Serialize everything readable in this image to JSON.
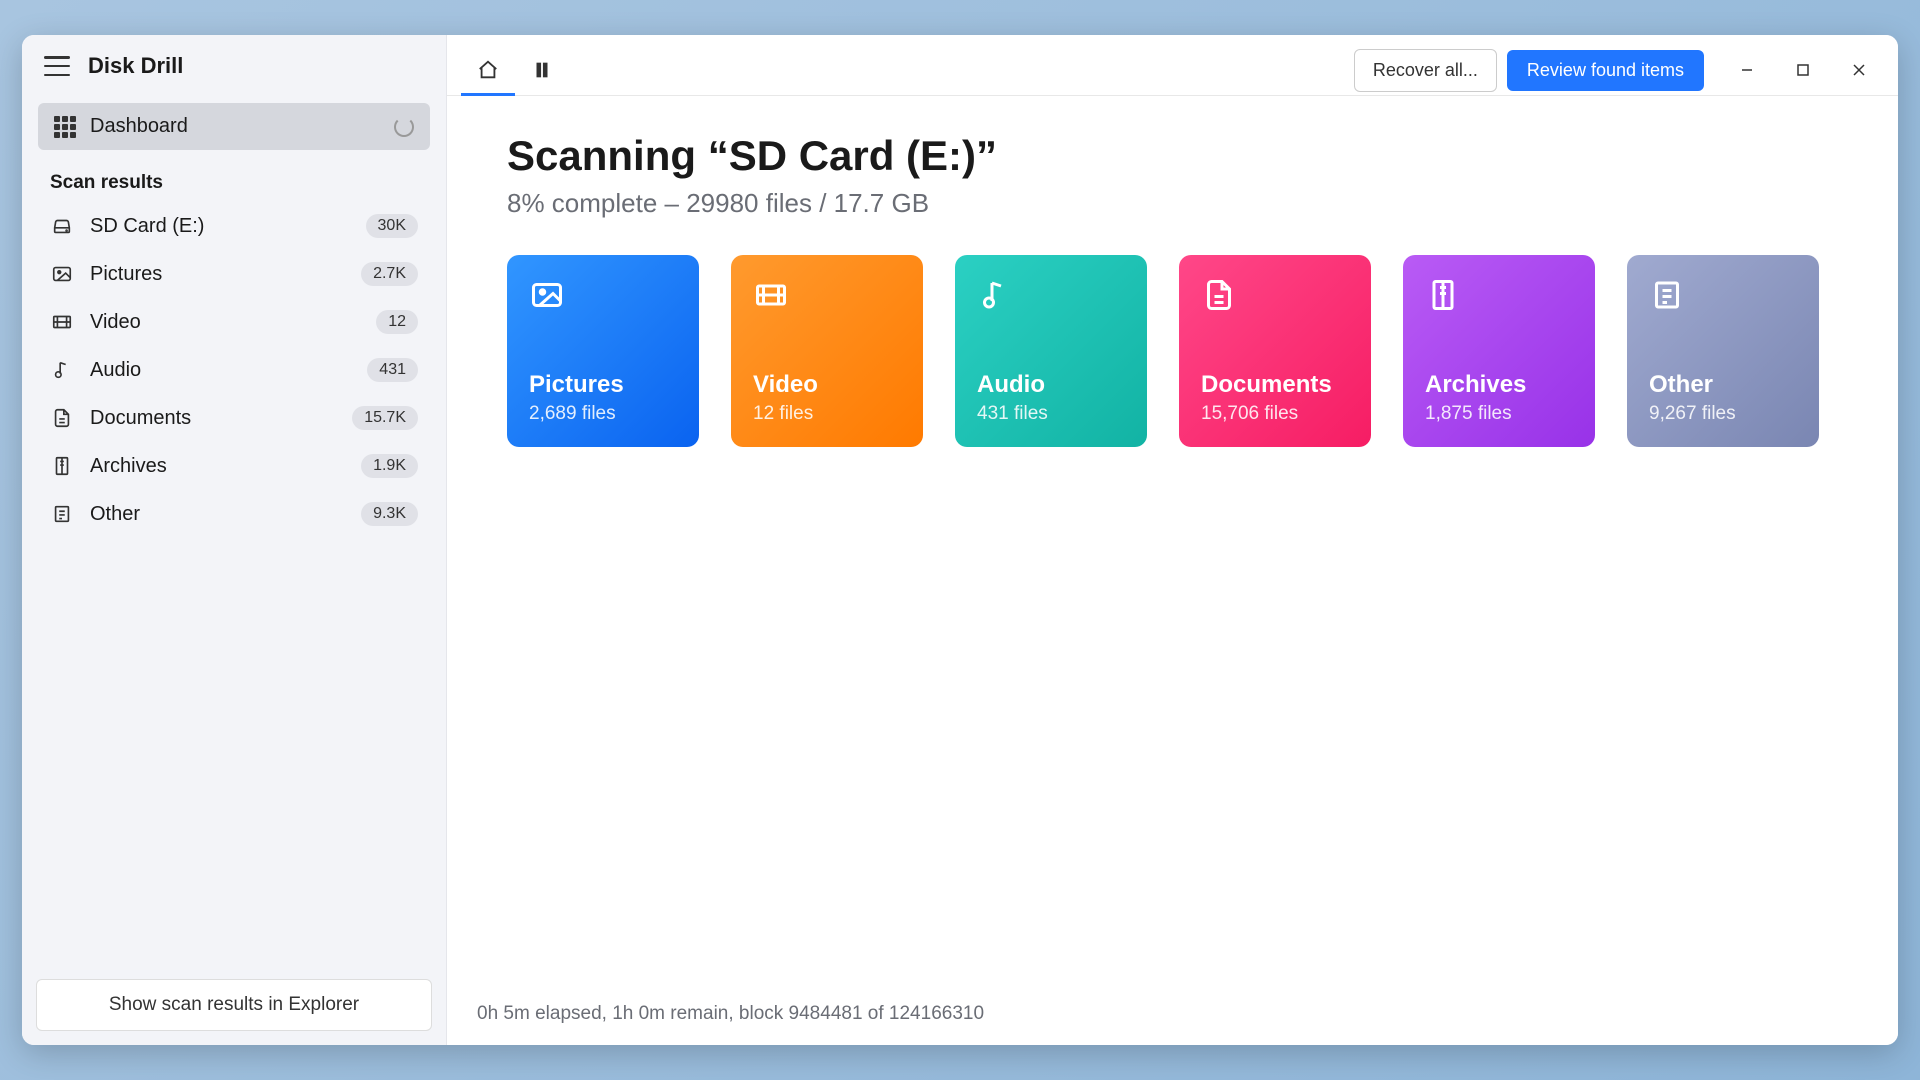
{
  "app_title": "Disk Drill",
  "dashboard_label": "Dashboard",
  "section_title": "Scan results",
  "sidebar_items": [
    {
      "label": "SD Card (E:)",
      "badge": "30K",
      "icon": "drive"
    },
    {
      "label": "Pictures",
      "badge": "2.7K",
      "icon": "image"
    },
    {
      "label": "Video",
      "badge": "12",
      "icon": "video"
    },
    {
      "label": "Audio",
      "badge": "431",
      "icon": "audio"
    },
    {
      "label": "Documents",
      "badge": "15.7K",
      "icon": "document"
    },
    {
      "label": "Archives",
      "badge": "1.9K",
      "icon": "archive"
    },
    {
      "label": "Other",
      "badge": "9.3K",
      "icon": "other"
    }
  ],
  "explorer_button": "Show scan results in Explorer",
  "titlebar": {
    "recover_label": "Recover all...",
    "review_label": "Review found items"
  },
  "page": {
    "title": "Scanning “SD Card (E:)”",
    "subtitle": "8% complete – 29980 files / 17.7 GB"
  },
  "cards": [
    {
      "title": "Pictures",
      "sub": "2,689 files"
    },
    {
      "title": "Video",
      "sub": "12 files"
    },
    {
      "title": "Audio",
      "sub": "431 files"
    },
    {
      "title": "Documents",
      "sub": "15,706 files"
    },
    {
      "title": "Archives",
      "sub": "1,875 files"
    },
    {
      "title": "Other",
      "sub": "9,267 files"
    }
  ],
  "status": "0h 5m elapsed, 1h 0m remain, block 9484481 of 124166310"
}
